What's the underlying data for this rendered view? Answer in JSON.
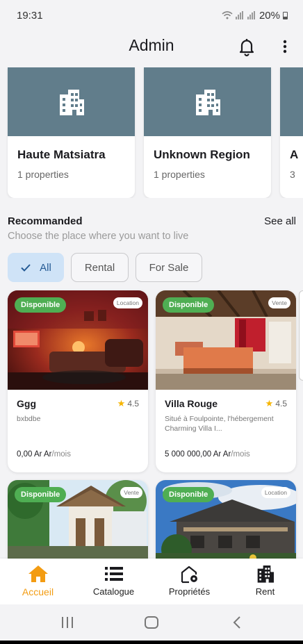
{
  "status_bar": {
    "time": "19:31",
    "battery": "20%"
  },
  "app_bar": {
    "title": "Admin",
    "notification_icon": "bell-icon",
    "menu_icon": "more-vert-icon"
  },
  "regions": [
    {
      "name": "Haute Matsiatra",
      "count": "1 properties",
      "icon": "building-icon"
    },
    {
      "name": "Unknown Region",
      "count": "1 properties",
      "icon": "building-icon"
    },
    {
      "name": "A",
      "count": "3",
      "icon": "building-icon"
    }
  ],
  "recommended": {
    "title": "Recommanded",
    "see_all": "See all",
    "subtitle": "Choose the place where you want to live"
  },
  "filters": [
    {
      "label": "All",
      "selected": true
    },
    {
      "label": "Rental",
      "selected": false
    },
    {
      "label": "For Sale",
      "selected": false
    }
  ],
  "properties": [
    {
      "status": "Disponible",
      "type": "Location",
      "title": "Ggg",
      "rating": "4.5",
      "description": "bxbdbe",
      "price": "0,00 Ar Ar",
      "period": "/mois"
    },
    {
      "status": "Disponible",
      "type": "Vente",
      "title": "Villa Rouge",
      "rating": "4.5",
      "description": "Situé à Foulpointe, l'hébergement Charming Villa I...",
      "price": "5 000 000,00 Ar Ar",
      "period": "/mois"
    },
    {
      "status": "Disponible",
      "type": "Vente"
    },
    {
      "status": "Disponible",
      "type": "Location"
    }
  ],
  "bottom_nav": [
    {
      "label": "Accueil",
      "icon": "home-icon",
      "active": true
    },
    {
      "label": "Catalogue",
      "icon": "list-icon",
      "active": false
    },
    {
      "label": "Propriétés",
      "icon": "house-settings-icon",
      "active": false
    },
    {
      "label": "Rent",
      "icon": "building-icon",
      "active": false
    }
  ],
  "colors": {
    "accent": "#f39c12",
    "available": "#4fae53",
    "chip_selected": "#cfe3f7",
    "region_banner": "#617d8b"
  }
}
